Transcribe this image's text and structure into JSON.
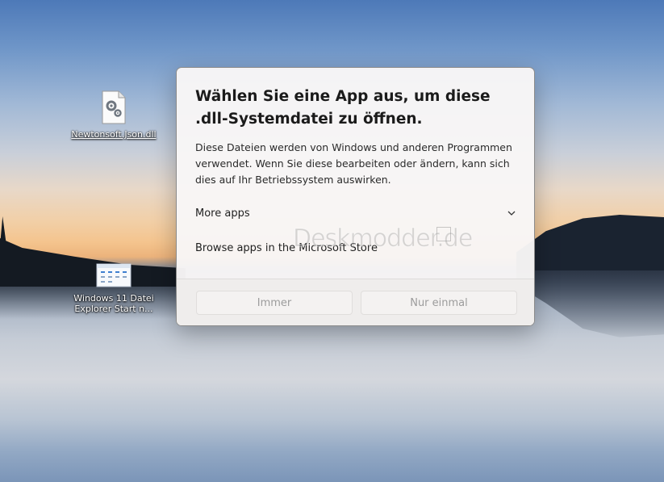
{
  "desktop": {
    "icons": [
      {
        "label": "Newtonsoft.Json.dll",
        "icon": "dll-file-icon"
      },
      {
        "label_line1": "Windows 11 Datei",
        "label_line2": "Explorer Start n...",
        "icon": "explorer-shortcut-icon"
      }
    ]
  },
  "dialog": {
    "title": "Wählen Sie eine App aus, um diese .dll-Systemdatei zu öffnen.",
    "description": "Diese Dateien werden von Windows und anderen Programmen verwendet. Wenn Sie diese bearbeiten oder ändern, kann sich dies auf Ihr Betriebssystem auswirken.",
    "more_apps_label": "More apps",
    "browse_store_label": "Browse apps in the Microsoft Store",
    "watermark": "Deskmodder.de",
    "buttons": {
      "always": "Immer",
      "once": "Nur einmal"
    }
  },
  "colors": {
    "dialog_bg": "#f8f6f6",
    "button_disabled_text": "#9c9c9c",
    "title_text": "#1b1b1b"
  }
}
